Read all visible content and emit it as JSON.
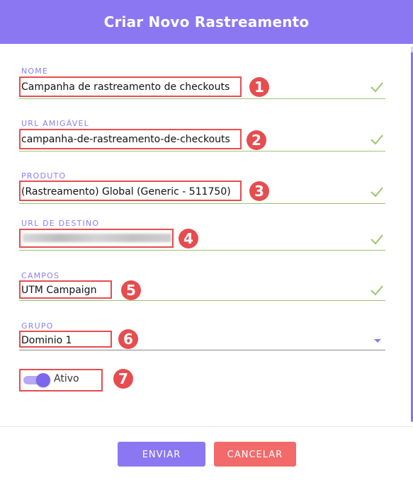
{
  "dialog": {
    "title": "Criar Novo Rastreamento"
  },
  "fields": [
    {
      "label": "Nome",
      "value": "Campanha de rastreamento de checkouts",
      "marker": "1"
    },
    {
      "label": "URL Amigável",
      "value": "campanha-de-rastreamento-de-checkouts",
      "marker": "2"
    },
    {
      "label": "Produto",
      "value": "(Rastreamento) Global (Generic - 511750)",
      "marker": "3"
    },
    {
      "label": "URL de Destino",
      "value": "",
      "marker": "4"
    },
    {
      "label": "Campos",
      "value": "UTM Campaign",
      "marker": "5"
    },
    {
      "label": "Grupo",
      "value": "Dominio 1",
      "marker": "6"
    }
  ],
  "toggle": {
    "label": "Ativo",
    "marker": "7",
    "on": true
  },
  "buttons": {
    "send": "ENVIAR",
    "cancel": "CANCELAR"
  },
  "colors": {
    "accent": "#8c77f2",
    "valid": "#9cc56f",
    "annotation": "#e74c4f",
    "cancel": "#f26a6a"
  },
  "icons": {
    "valid": "check-icon",
    "dropdown": "chevron-down-icon"
  }
}
